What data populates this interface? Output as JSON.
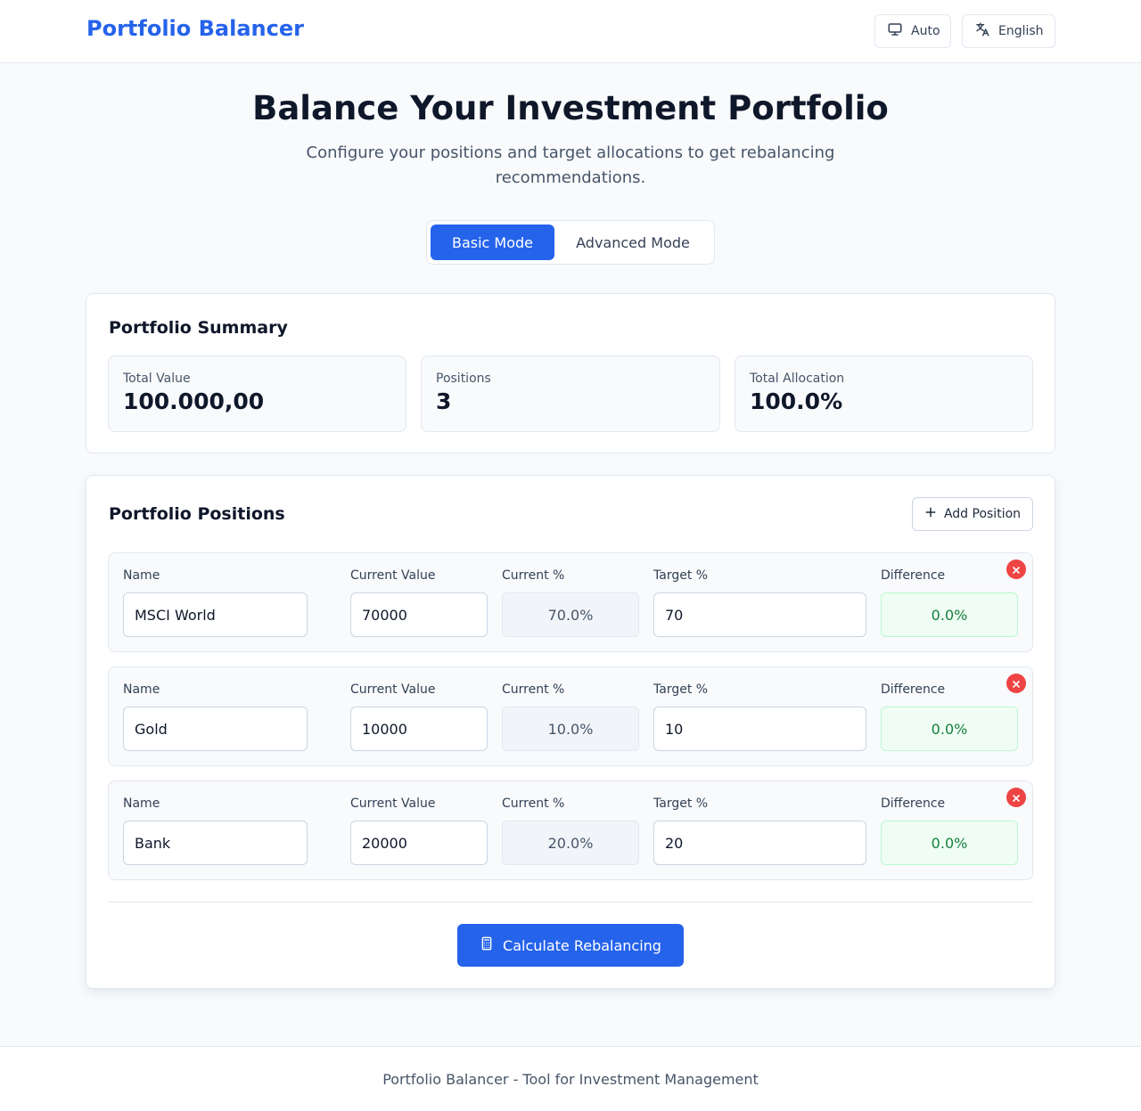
{
  "header": {
    "brand": "Portfolio Balancer",
    "theme_label": "Auto",
    "theme_icon": "monitor-icon",
    "language_label": "English",
    "language_icon": "translate-icon"
  },
  "hero": {
    "title": "Balance Your Investment Portfolio",
    "subtitle": "Configure your positions and target allocations to get rebalancing recommendations."
  },
  "modes": {
    "basic": "Basic Mode",
    "advanced": "Advanced Mode",
    "active": "basic"
  },
  "summary": {
    "title": "Portfolio Summary",
    "stats": [
      {
        "label": "Total Value",
        "value": "100.000,00"
      },
      {
        "label": "Positions",
        "value": "3"
      },
      {
        "label": "Total Allocation",
        "value": "100.0%"
      }
    ]
  },
  "positions": {
    "title": "Portfolio Positions",
    "add_label": "Add Position",
    "columns": {
      "name": "Name",
      "current_value": "Current Value",
      "current_pct": "Current %",
      "target_pct": "Target %",
      "difference": "Difference"
    },
    "rows": [
      {
        "name": "MSCI World",
        "current_value": "70000",
        "current_pct": "70.0%",
        "target_pct": "70",
        "difference": "0.0%"
      },
      {
        "name": "Gold",
        "current_value": "10000",
        "current_pct": "10.0%",
        "target_pct": "10",
        "difference": "0.0%"
      },
      {
        "name": "Bank",
        "current_value": "20000",
        "current_pct": "20.0%",
        "target_pct": "20",
        "difference": "0.0%"
      }
    ],
    "calculate_label": "Calculate Rebalancing",
    "calculate_icon": "calculator-icon"
  },
  "footer": {
    "text": "Portfolio Balancer - Tool for Investment Management"
  },
  "colors": {
    "accent": "#2563eb",
    "danger": "#ef4444",
    "success": "#15803d"
  }
}
